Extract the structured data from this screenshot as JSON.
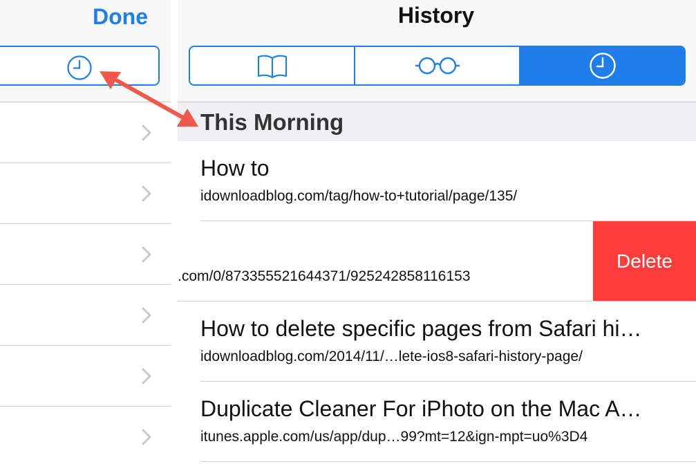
{
  "left_panel": {
    "done_label": "Done",
    "rows": [
      1,
      2,
      3,
      4,
      5,
      6
    ]
  },
  "header": {
    "title": "History",
    "tabs": [
      {
        "name": "bookmarks",
        "icon": "book-icon",
        "active": false
      },
      {
        "name": "reading-list",
        "icon": "glasses-icon",
        "active": false
      },
      {
        "name": "history",
        "icon": "clock-icon",
        "active": true
      }
    ]
  },
  "section": {
    "title": "This Morning"
  },
  "items": [
    {
      "title": "How to",
      "url": "idownloadblog.com/tag/how-to+tutorial/page/135/"
    },
    {
      "title": "",
      "url": ".com/0/873355521644371/925242858116153"
    },
    {
      "title": "How to delete specific pages from Safari hi…",
      "url": "idownloadblog.com/2014/11/…lete-ios8-safari-history-page/"
    },
    {
      "title": "Duplicate Cleaner For iPhoto on the Mac A…",
      "url": "itunes.apple.com/us/app/dup…99?mt=12&ign-mpt=uo%3D4"
    }
  ],
  "delete_label": "Delete",
  "colors": {
    "accent": "#1f7ee9",
    "delete": "#fc3d39",
    "annotation_arrow": "#f0584a",
    "section_bg": "#efeff4"
  }
}
